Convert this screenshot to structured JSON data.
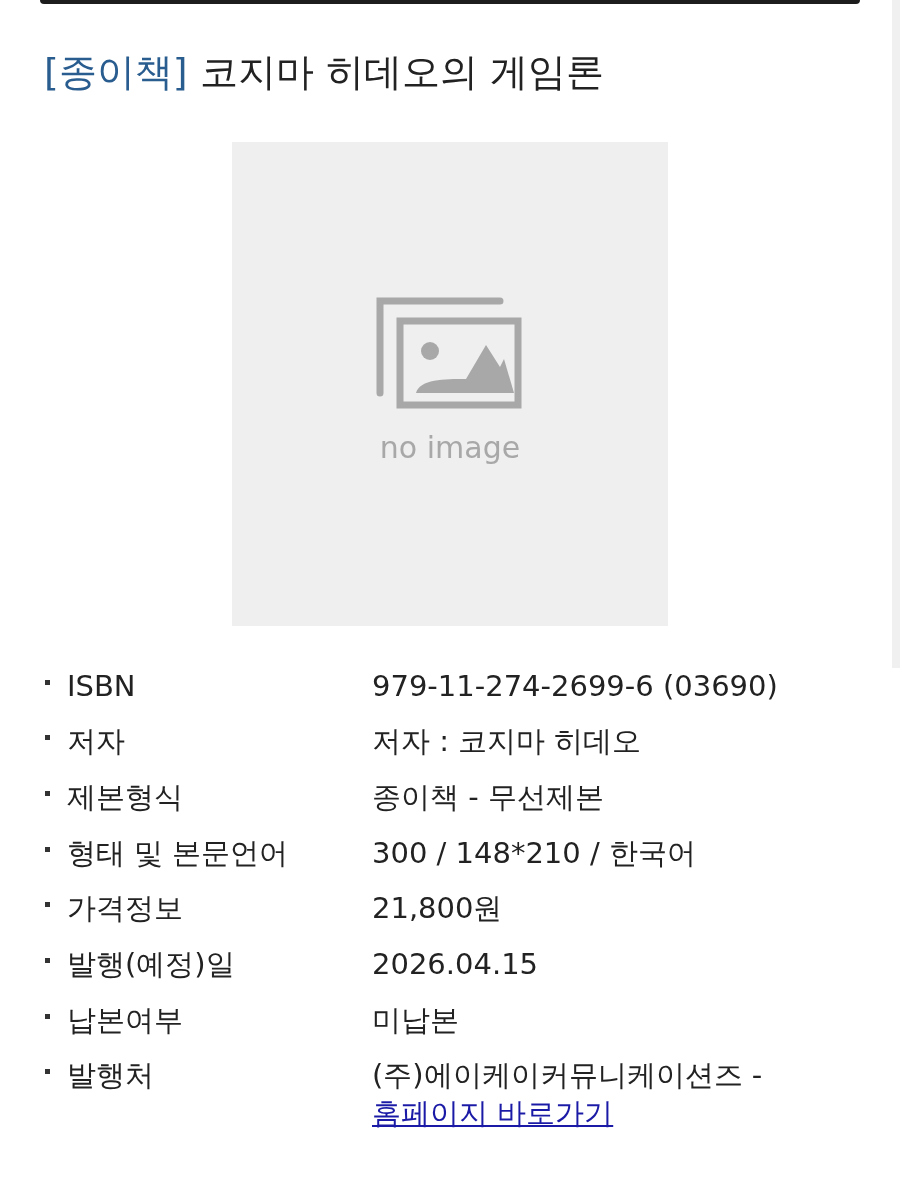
{
  "title": {
    "tag": "[종이책]",
    "text": "코지마 히데오의 게임론"
  },
  "cover": {
    "placeholder_label": "no image"
  },
  "details": [
    {
      "label": "ISBN",
      "value": "979-11-274-2699-6 (03690)"
    },
    {
      "label": "저자",
      "value": "저자 : 코지마 히데오"
    },
    {
      "label": "제본형식",
      "value": "종이책 - 무선제본"
    },
    {
      "label": "형태 및 본문언어",
      "value": "300 / 148*210 / 한국어"
    },
    {
      "label": "가격정보",
      "value": "21,800원"
    },
    {
      "label": "발행(예정)일",
      "value": "2026.04.15"
    },
    {
      "label": "납본여부",
      "value": "미납본"
    },
    {
      "label": "발행처",
      "value": "(주)에이케이커뮤니케이션즈 - ",
      "link": "홈페이지 바로가기"
    }
  ]
}
